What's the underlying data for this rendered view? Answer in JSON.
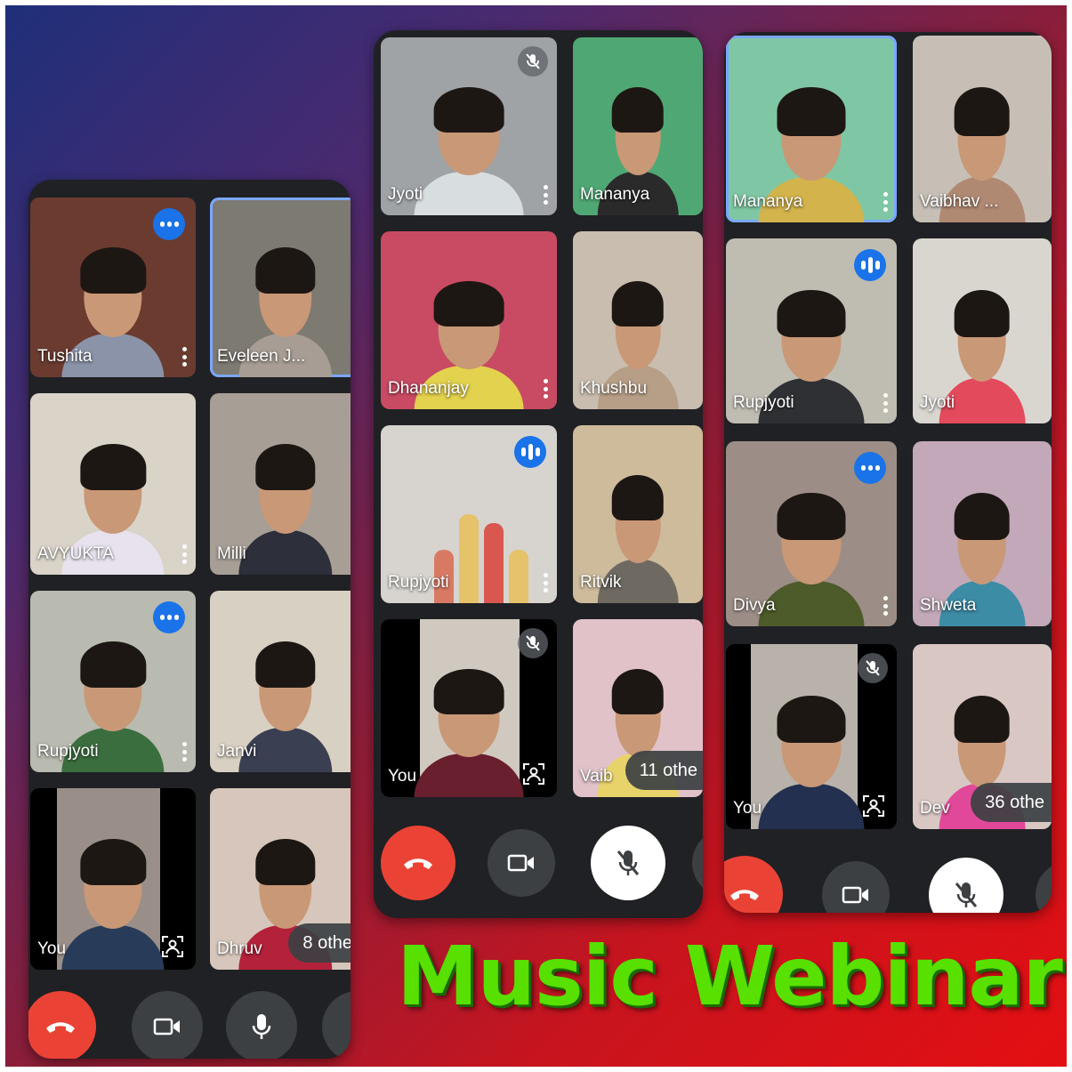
{
  "title": "Music Webinar",
  "colors": {
    "meet_bg": "#202124",
    "tile_bg": "#3c4043",
    "end_call": "#ea4335",
    "speaking_blue": "#1a73e8",
    "title_green": "#57e000"
  },
  "icons": {
    "end_call": "phone-hangup-icon",
    "camera": "video-camera-icon",
    "mic": "microphone-icon",
    "mic_off": "microphone-off-icon",
    "speaking": "audio-level-icon",
    "more": "more-vert-icon",
    "frame": "framing-icon"
  },
  "phones": [
    {
      "tiles": [
        {
          "name": "Tushita",
          "indicator": "speaking",
          "menu": true
        },
        {
          "name": "Eveleen J...",
          "indicator": "none",
          "menu": false,
          "active": true
        },
        {
          "name": "AVYUKTA",
          "indicator": "none",
          "menu": true
        },
        {
          "name": "Milli",
          "indicator": "none",
          "menu": false
        },
        {
          "name": "Rupjyoti",
          "indicator": "speaking",
          "menu": true
        },
        {
          "name": "Janvi",
          "indicator": "none",
          "menu": false
        },
        {
          "name": "You",
          "indicator": "frame",
          "menu": false
        },
        {
          "name": "Dhruv",
          "indicator": "none",
          "menu": false,
          "others": "8 othe"
        }
      ],
      "controls": [
        "end_call",
        "camera",
        "mic",
        "more"
      ]
    },
    {
      "tiles": [
        {
          "name": "Jyoti",
          "indicator": "muted",
          "menu": true
        },
        {
          "name": "Mananya",
          "indicator": "none",
          "menu": false
        },
        {
          "name": "Dhananjay",
          "indicator": "none",
          "menu": true
        },
        {
          "name": "Khushbu",
          "indicator": "none",
          "menu": false
        },
        {
          "name": "Rupjyoti",
          "indicator": "speaking",
          "menu": true
        },
        {
          "name": "Ritvik",
          "indicator": "none",
          "menu": false
        },
        {
          "name": "You",
          "indicator": "muted_frame",
          "menu": false
        },
        {
          "name": "Vaib",
          "indicator": "none",
          "menu": false,
          "others": "11 othe"
        }
      ],
      "controls": [
        "end_call",
        "camera",
        "mic_off",
        "more"
      ]
    },
    {
      "tiles": [
        {
          "name": "Mananya",
          "indicator": "none",
          "menu": true,
          "active": true
        },
        {
          "name": "Vaibhav ...",
          "indicator": "none",
          "menu": false
        },
        {
          "name": "Rupjyoti",
          "indicator": "speaking",
          "menu": true
        },
        {
          "name": "Jyoti",
          "indicator": "none",
          "menu": false
        },
        {
          "name": "Divya",
          "indicator": "speaking",
          "menu": true
        },
        {
          "name": "Shweta",
          "indicator": "none",
          "menu": false
        },
        {
          "name": "You",
          "indicator": "muted_frame",
          "menu": false
        },
        {
          "name": "Dev",
          "indicator": "none",
          "menu": false,
          "others": "36 othe"
        }
      ],
      "controls": [
        "end_call",
        "camera",
        "mic_off",
        "more"
      ]
    }
  ]
}
